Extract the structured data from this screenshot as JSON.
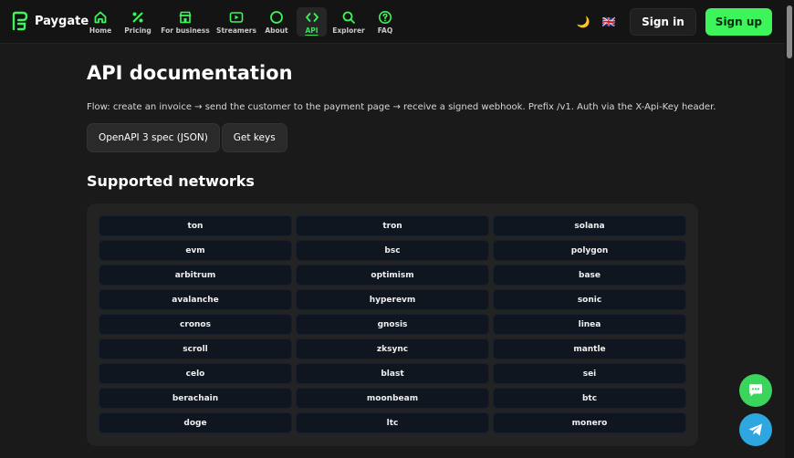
{
  "brand": {
    "name": "Paygate",
    "accent": "#3df55a"
  },
  "nav": [
    {
      "label": "Home",
      "icon": "home-icon",
      "active": false
    },
    {
      "label": "Pricing",
      "icon": "percent-icon",
      "active": false
    },
    {
      "label": "For business",
      "icon": "store-icon",
      "active": false
    },
    {
      "label": "Streamers",
      "icon": "play-icon",
      "active": false
    },
    {
      "label": "About",
      "icon": "circle-icon",
      "active": false
    },
    {
      "label": "API",
      "icon": "code-icon",
      "active": true
    },
    {
      "label": "Explorer",
      "icon": "search-icon",
      "active": false
    },
    {
      "label": "FAQ",
      "icon": "question-icon",
      "active": false
    }
  ],
  "header": {
    "theme_icon": "🌙",
    "lang_icon": "🇬🇧",
    "sign_in": "Sign in",
    "sign_up": "Sign up"
  },
  "page": {
    "title": "API documentation",
    "flow": "Flow: create an invoice → send the customer to the payment page → receive a signed webhook. Prefix /v1. Auth via the X-Api-Key header.",
    "buttons": [
      "OpenAPI 3 spec (JSON)",
      "Get keys"
    ],
    "networks_title": "Supported networks",
    "networks": [
      "ton",
      "tron",
      "solana",
      "evm",
      "bsc",
      "polygon",
      "arbitrum",
      "optimism",
      "base",
      "avalanche",
      "hyperevm",
      "sonic",
      "cronos",
      "gnosis",
      "linea",
      "scroll",
      "zksync",
      "mantle",
      "celo",
      "blast",
      "sei",
      "berachain",
      "moonbeam",
      "btc",
      "doge",
      "ltc",
      "monero"
    ]
  },
  "floating": {
    "chat_icon": "chat-icon",
    "telegram_icon": "telegram-icon"
  }
}
